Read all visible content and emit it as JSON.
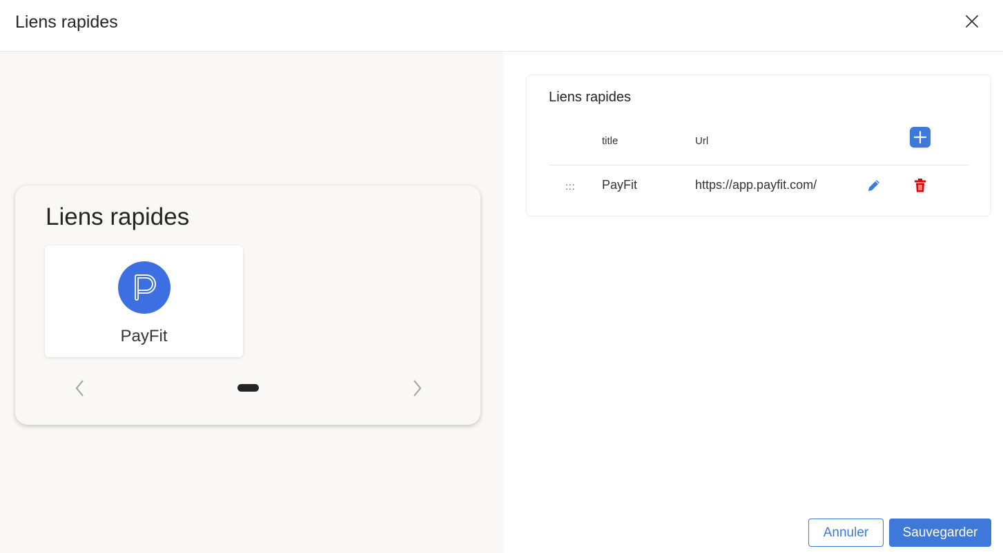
{
  "dialog": {
    "title": "Liens rapides"
  },
  "preview": {
    "title": "Liens rapides",
    "tiles": [
      {
        "label": "PayFit",
        "icon": "payfit-logo-icon",
        "color": "#3e6fe2"
      }
    ],
    "pagination": {
      "pages": 1,
      "current": 1
    }
  },
  "settings": {
    "title": "Liens rapides",
    "columns": {
      "title": "title",
      "url": "Url"
    },
    "rows": [
      {
        "title": "PayFit",
        "url": "https://app.payfit.com/"
      }
    ]
  },
  "footer": {
    "cancel_label": "Annuler",
    "save_label": "Sauvegarder"
  },
  "colors": {
    "accent": "#3e78d8",
    "danger": "#e00000",
    "preview_background": "#f9f8f6"
  }
}
